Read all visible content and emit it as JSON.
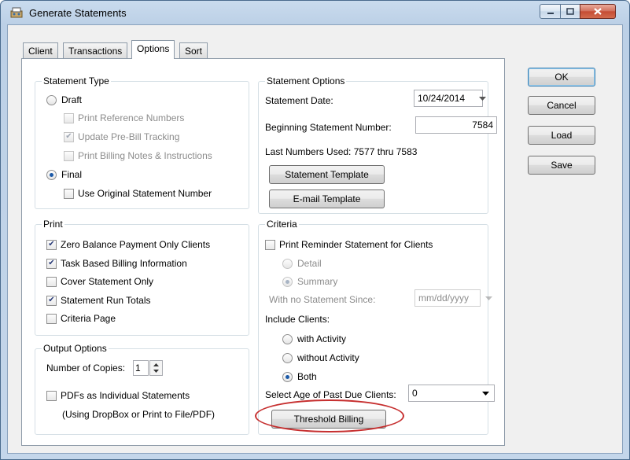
{
  "window": {
    "title": "Generate Statements"
  },
  "tabs": [
    {
      "label": "Client"
    },
    {
      "label": "Transactions"
    },
    {
      "label": "Options"
    },
    {
      "label": "Sort"
    }
  ],
  "statement_type": {
    "title": "Statement Type",
    "draft_label": "Draft",
    "print_reference_numbers": "Print Reference Numbers",
    "update_prebill_tracking": "Update Pre-Bill Tracking",
    "print_billing_notes": "Print Billing Notes & Instructions",
    "final_label": "Final",
    "use_original_number": "Use Original Statement Number"
  },
  "print": {
    "title": "Print",
    "zero_balance": "Zero Balance Payment Only Clients",
    "task_based": "Task Based Billing Information",
    "cover_only": "Cover Statement Only",
    "run_totals": "Statement Run Totals",
    "criteria_page": "Criteria Page"
  },
  "output_options": {
    "title": "Output Options",
    "copies_label": "Number of Copies:",
    "copies_value": "1",
    "pdfs_individual": "PDFs as Individual Statements",
    "pdfs_note": "(Using DropBox or Print to File/PDF)"
  },
  "statement_options": {
    "title": "Statement Options",
    "date_label": "Statement Date:",
    "date_value": "10/24/2014",
    "beginning_label": "Beginning Statement Number:",
    "beginning_value": "7584",
    "last_used": "Last Numbers Used: 7577 thru 7583",
    "template_button": "Statement Template",
    "email_template_button": "E-mail Template"
  },
  "criteria": {
    "title": "Criteria",
    "print_reminder": "Print Reminder Statement for Clients",
    "detail": "Detail",
    "summary": "Summary",
    "no_statement_since": "With no Statement Since:",
    "date_placeholder": "mm/dd/yyyy",
    "include_clients": "Include Clients:",
    "with_activity": "with Activity",
    "without_activity": "without Activity",
    "both": "Both",
    "past_due_label": "Select Age of Past Due Clients:",
    "past_due_value": "0",
    "threshold_button": "Threshold Billing"
  },
  "actions": {
    "ok": "OK",
    "cancel": "Cancel",
    "load": "Load",
    "save": "Save"
  },
  "colors": {
    "highlight": "#c62f2f",
    "check": "#2a3c78"
  }
}
